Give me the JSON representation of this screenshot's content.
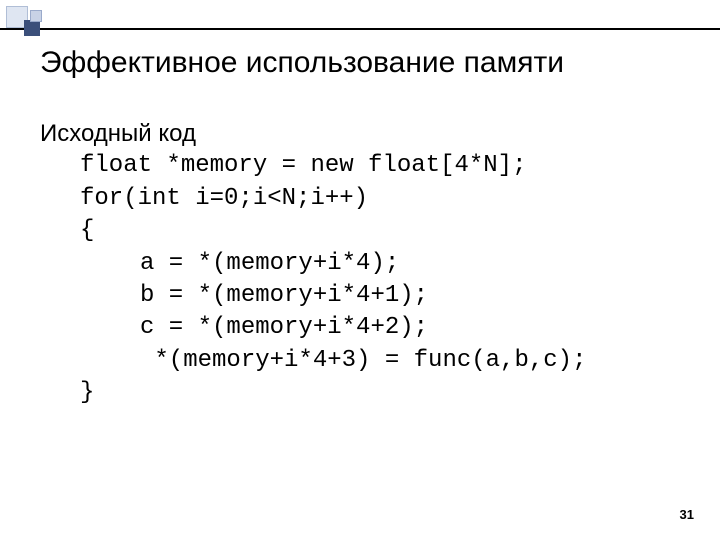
{
  "slide": {
    "title": "Эффективное использование памяти",
    "intro": "Исходный код",
    "code": {
      "l1": "float *memory = new float[4*N];",
      "l2": "for(int i=0;i<N;i++)",
      "l3": "{",
      "l4": "a = *(memory+i*4);",
      "l5": "b = *(memory+i*4+1);",
      "l6": "c = *(memory+i*4+2);",
      "l7": " *(memory+i*4+3) = func(a,b,c);",
      "l8": "}"
    },
    "page_number": "31"
  }
}
